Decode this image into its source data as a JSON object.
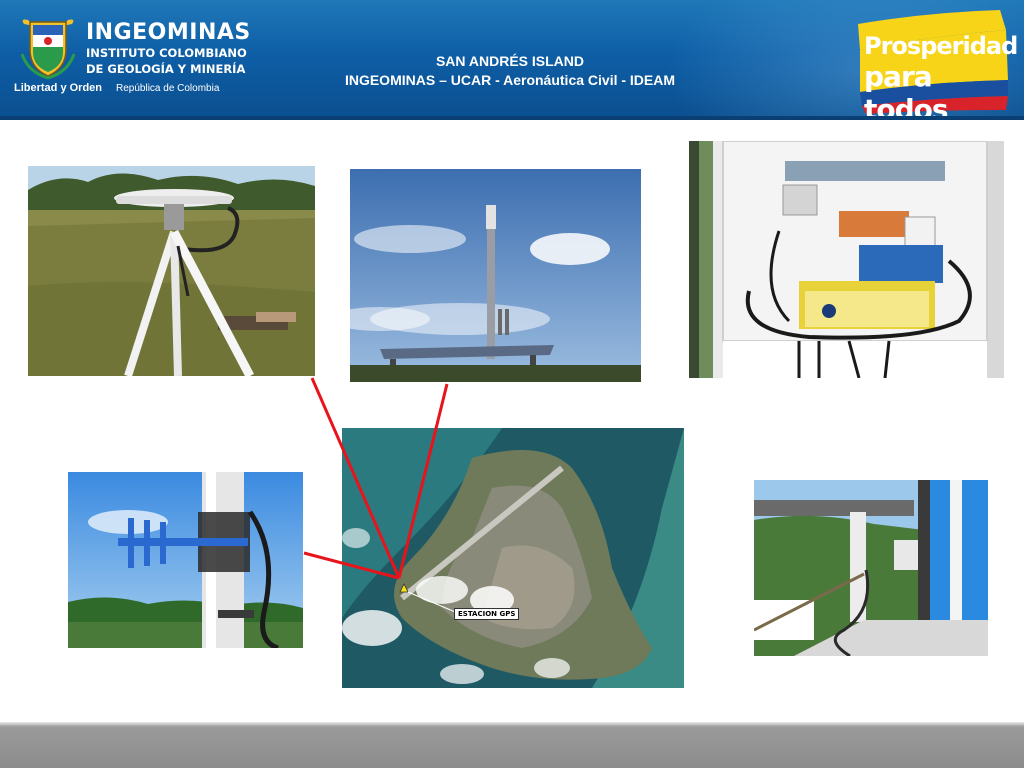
{
  "header": {
    "org_name": "INGEOMINAS",
    "org_full_line1": "INSTITUTO COLOMBIANO",
    "org_full_line2": "DE GEOLOGÍA Y MINERÍA",
    "slogan": "Libertad y Orden",
    "country": "República de Colombia",
    "title_line1": "SAN ANDRÉS ISLAND",
    "title_line2": "INGEOMINAS – UCAR - Aeronáutica Civil - IDEAM",
    "brand_line1": "Prosperidad",
    "brand_line2": "para todos"
  },
  "map": {
    "label": "ESTACION GPS"
  },
  "colors": {
    "header_blue": "#0e5ea6",
    "connector_red": "#e8141c",
    "footer_gray": "#8c8c8c",
    "flag_yellow": "#f7d417",
    "flag_blue": "#1a4fa0",
    "flag_red": "#d8232a"
  },
  "icons": [
    "colombia-crest-icon",
    "gps-marker-icon"
  ]
}
